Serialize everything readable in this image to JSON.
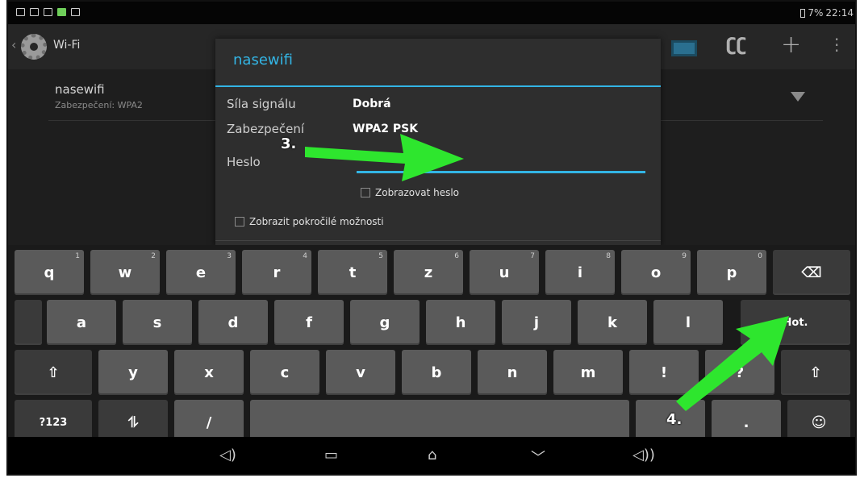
{
  "status": {
    "battery": "7%",
    "time": "22:14"
  },
  "actionbar": {
    "title": "Wi-Fi",
    "back": "‹"
  },
  "wifi_list": [
    {
      "name": "nasewifi",
      "security": "Zabezpečení: WPA2"
    }
  ],
  "dialog": {
    "title": "nasewifi",
    "rows": [
      {
        "label": "Síla signálu",
        "value": "Dobrá"
      },
      {
        "label": "Zabezpečení",
        "value": "WPA2 PSK"
      }
    ],
    "password_label": "Heslo",
    "show_password": "Zobrazovat heslo",
    "advanced": "Zobrazit pokročilé možnosti"
  },
  "keyboard": {
    "row1": [
      {
        "k": "q",
        "h": "1"
      },
      {
        "k": "w",
        "h": "2"
      },
      {
        "k": "e",
        "h": "3"
      },
      {
        "k": "r",
        "h": "4"
      },
      {
        "k": "t",
        "h": "5"
      },
      {
        "k": "z",
        "h": "6"
      },
      {
        "k": "u",
        "h": "7"
      },
      {
        "k": "i",
        "h": "8"
      },
      {
        "k": "o",
        "h": "9"
      },
      {
        "k": "p",
        "h": "0"
      }
    ],
    "backspace": "⌫",
    "row2": [
      "a",
      "s",
      "d",
      "f",
      "g",
      "h",
      "j",
      "k",
      "l"
    ],
    "done": "Hot.",
    "shift": "⇧",
    "row3": [
      "y",
      "x",
      "c",
      "v",
      "b",
      "n",
      "m",
      "!",
      "?"
    ],
    "symbols": "?123",
    "settings": "⥮",
    "slash": "/",
    "period": ".",
    "emoji": "☺"
  },
  "navbar": {
    "vol_down": "◁)",
    "recents": "▭",
    "home": "⌂",
    "hide": "﹀",
    "vol_up": "◁))"
  },
  "annotations": {
    "step3": "3.",
    "step4": "4."
  },
  "colors": {
    "accent": "#33b5e5",
    "arrow": "#2ee62e"
  }
}
